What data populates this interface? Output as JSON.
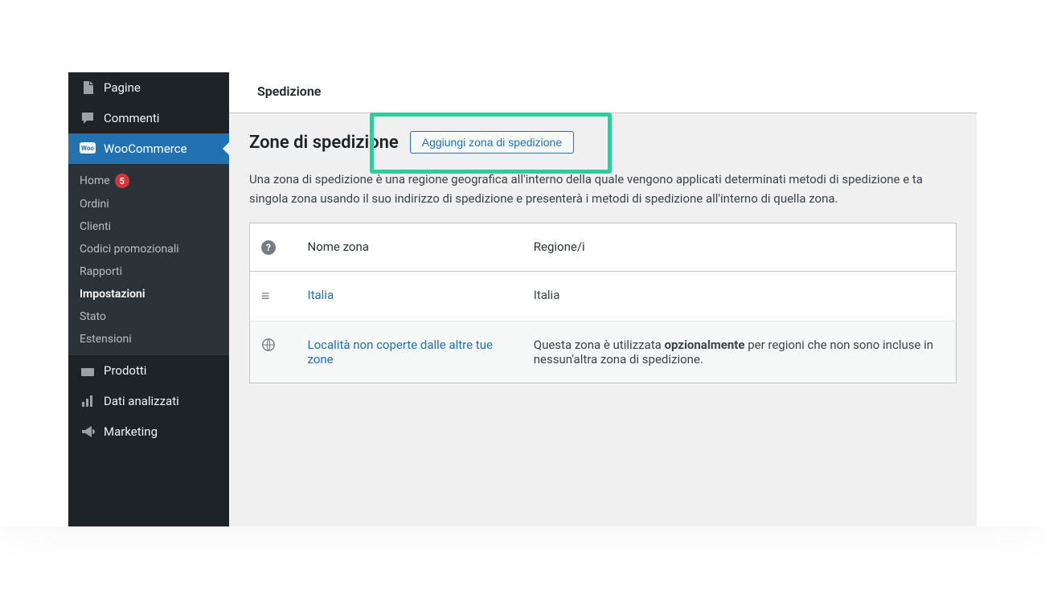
{
  "sidebar": {
    "items": [
      {
        "label": "Pagine",
        "icon": "pages"
      },
      {
        "label": "Commenti",
        "icon": "comment"
      },
      {
        "label": "WooCommerce",
        "icon": "woo",
        "active": true
      },
      {
        "label": "Prodotti",
        "icon": "products"
      },
      {
        "label": "Dati analizzati",
        "icon": "analytics"
      },
      {
        "label": "Marketing",
        "icon": "marketing"
      }
    ],
    "submenu": [
      {
        "label": "Home",
        "badge": "5"
      },
      {
        "label": "Ordini"
      },
      {
        "label": "Clienti"
      },
      {
        "label": "Codici promozionali"
      },
      {
        "label": "Rapporti"
      },
      {
        "label": "Impostazioni",
        "current": true
      },
      {
        "label": "Stato"
      },
      {
        "label": "Estensioni"
      }
    ]
  },
  "tab": {
    "label": "Spedizione"
  },
  "section": {
    "title": "Zone di spedizione",
    "add_button": "Aggiungi zona di spedizione",
    "description": "Una zona di spedizione è una regione geografica all'interno della quale vengono applicati determinati metodi di spedizione e ta singola zona usando il suo indirizzo di spedizione e presenterà i metodi di spedizione all'interno di quella zona."
  },
  "table": {
    "headers": {
      "name": "Nome zona",
      "region": "Regione/i"
    },
    "rows": [
      {
        "name": "Italia",
        "region": "Italia"
      }
    ],
    "fallback": {
      "name": "Località non coperte dalle altre tue zone",
      "desc_pre": "Questa zona è utilizzata ",
      "desc_bold": "opzionalmente",
      "desc_post": " per regioni che non sono incluse in nessun'altra zona di spedizione."
    }
  }
}
